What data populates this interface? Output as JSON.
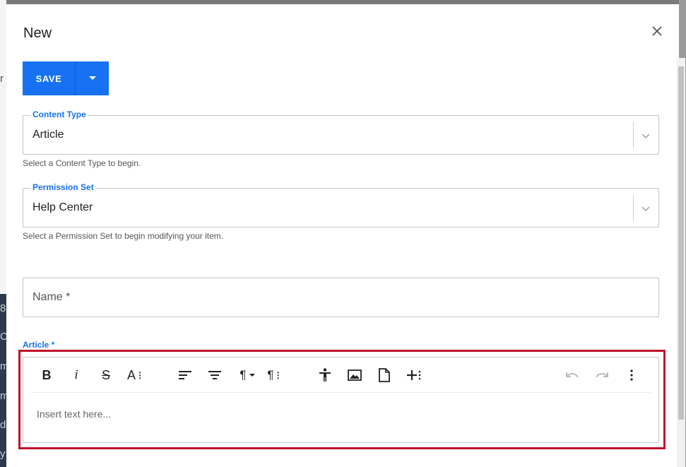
{
  "dialog": {
    "title": "New",
    "close_icon": "close-icon"
  },
  "actions": {
    "save_label": "SAVE",
    "menu_icon": "caret-down-icon"
  },
  "content_type": {
    "label": "Content Type",
    "value": "Article",
    "helper": "Select a Content Type to begin."
  },
  "permission_set": {
    "label": "Permission Set",
    "value": "Help Center",
    "helper": "Select a Permission Set to begin modifying your item."
  },
  "name": {
    "label": "Name *"
  },
  "article": {
    "label": "Article *",
    "placeholder": "Insert text here...",
    "toolbar": {
      "bold": "B",
      "italic": "i",
      "strike": "S",
      "font_size": "A",
      "paragraph": "¶",
      "paragraph_style": "¶",
      "icons": [
        "bold-icon",
        "italic-icon",
        "strikethrough-icon",
        "font-size-icon",
        "align-left-icon",
        "align-center-icon",
        "paragraph-format-icon",
        "paragraph-style-icon",
        "accessibility-icon",
        "image-icon",
        "file-icon",
        "insert-more-icon",
        "undo-icon",
        "redo-icon",
        "more-vertical-icon"
      ]
    }
  },
  "background": {
    "fragments": [
      "r",
      "8",
      "C",
      "m",
      "m",
      "d",
      "y"
    ]
  },
  "colors": {
    "primary": "#1672f3",
    "highlight": "#c0102c"
  }
}
